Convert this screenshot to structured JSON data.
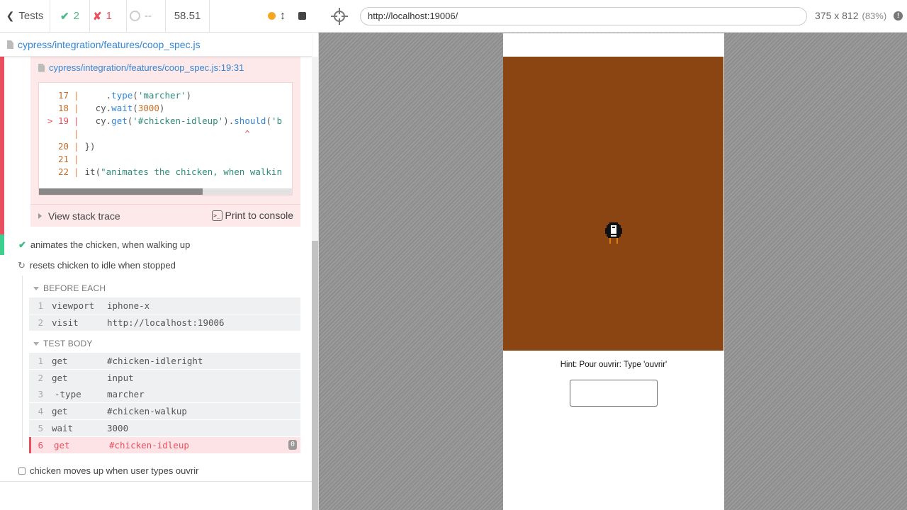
{
  "reporter": {
    "stats": {
      "tests_label": "Tests",
      "passed_count": "2",
      "failed_count": "1",
      "pending_count": "--",
      "duration": "58.51"
    },
    "spec_file": "cypress/integration/features/coop_spec.js",
    "error": {
      "codeframe_file": "cypress/integration/features/coop_spec.js:19:31",
      "code_lines": [
        {
          "num": "17",
          "code": "    .type('marcher')"
        },
        {
          "num": "18",
          "code": "  cy.wait(3000)"
        },
        {
          "num": "> 19",
          "code": "  cy.get('#chicken-idleup').should('b"
        },
        {
          "num": "",
          "code": "                              ^"
        },
        {
          "num": "20",
          "code": "})"
        },
        {
          "num": "21",
          "code": ""
        },
        {
          "num": "22",
          "code": "it(\"animates the chicken, when walkin"
        }
      ],
      "view_stack_trace": "View stack trace",
      "print_to_console": "Print to console",
      "term_icon_text": ">_"
    },
    "tests": {
      "passed_title": "animates the chicken, when walking up",
      "running_title": "resets chicken to idle when stopped",
      "pending_title": "chicken moves up when user types ouvrir"
    },
    "before_each": {
      "title": "BEFORE EACH",
      "commands": [
        {
          "num": "1",
          "name": "viewport",
          "message": "iphone-x"
        },
        {
          "num": "2",
          "name": "visit",
          "message": "http://localhost:19006"
        }
      ]
    },
    "test_body": {
      "title": "TEST BODY",
      "commands": [
        {
          "num": "1",
          "name": "get",
          "message": "#chicken-idleright"
        },
        {
          "num": "2",
          "name": "get",
          "message": "input"
        },
        {
          "num": "3",
          "name": "-type",
          "message": "marcher"
        },
        {
          "num": "4",
          "name": "get",
          "message": "#chicken-walkup"
        },
        {
          "num": "5",
          "name": "wait",
          "message": "3000"
        },
        {
          "num": "6",
          "name": "get",
          "message": "#chicken-idleup",
          "badge": "0"
        }
      ]
    }
  },
  "aut": {
    "url": "http://localhost:19006/",
    "viewport_size": "375 x 812",
    "scale": "(83%)",
    "info_icon": "!",
    "app": {
      "background_color": "#8b4513",
      "hint": "Hint: Pour ouvrir: Type 'ouvrir'",
      "input_value": ""
    }
  },
  "colors": {
    "pass": "#3ccf8e",
    "fail": "#e94f5f",
    "running": "#f5a623",
    "link": "#3386d4"
  }
}
